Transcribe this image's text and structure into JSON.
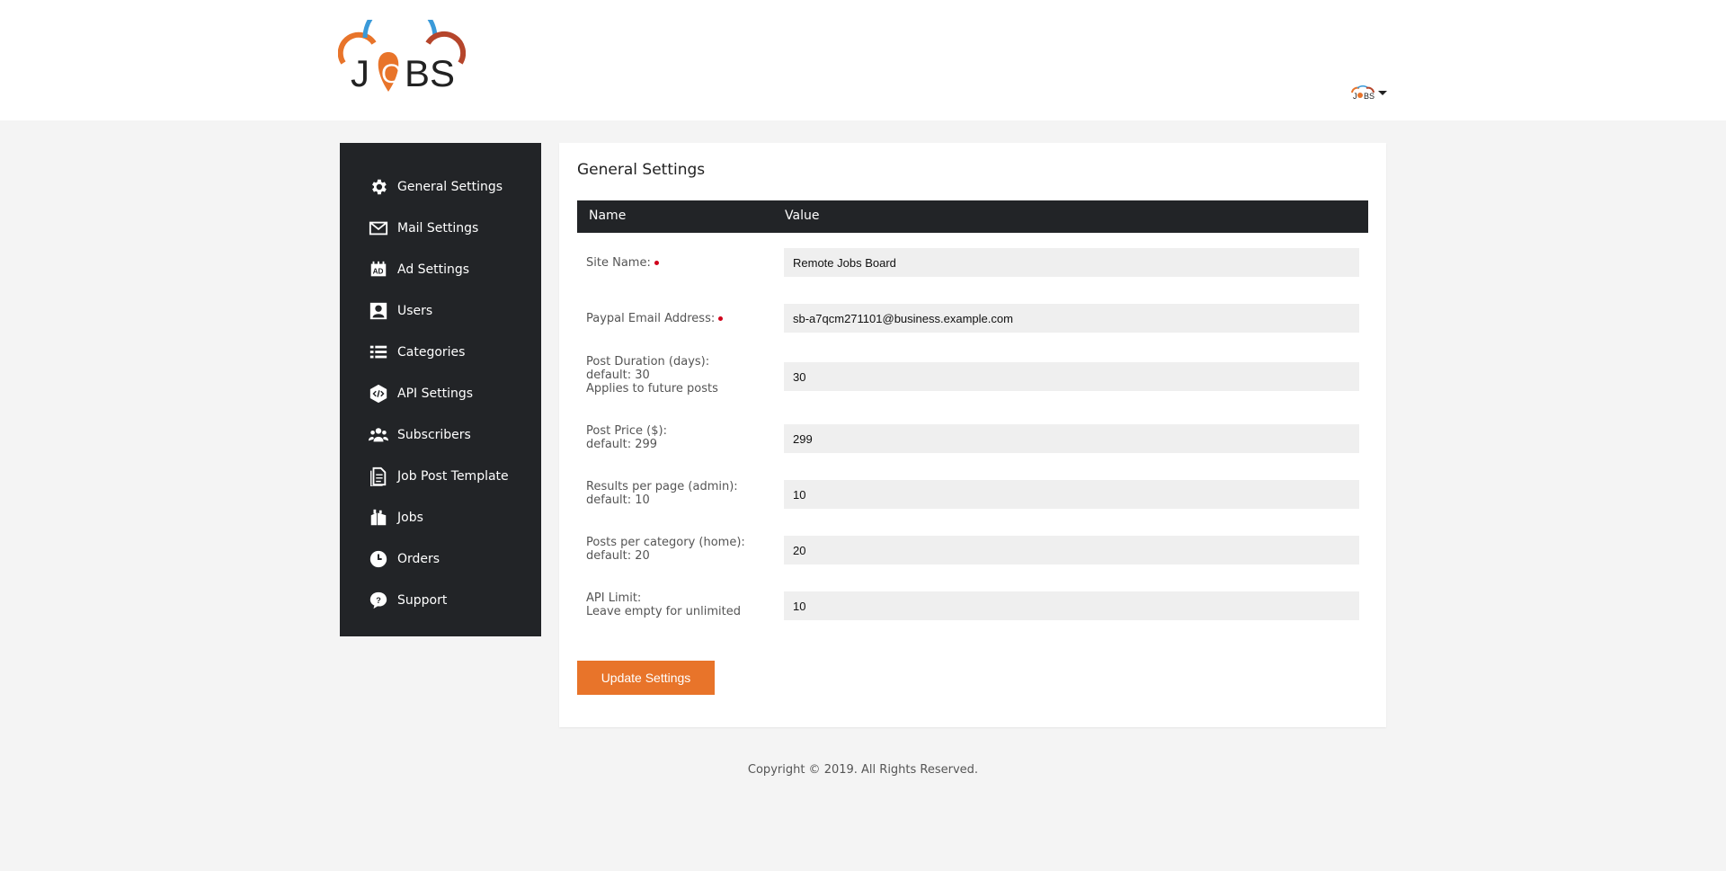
{
  "header": {
    "logo_icon": "jobs-logo",
    "user_menu_icon": "jobs-mini-logo",
    "caret_icon": "caret-down-icon"
  },
  "sidebar": {
    "items": [
      {
        "label": "General Settings",
        "icon": "gear-icon"
      },
      {
        "label": "Mail Settings",
        "icon": "envelope-icon"
      },
      {
        "label": "Ad Settings",
        "icon": "ad-icon"
      },
      {
        "label": "Users",
        "icon": "user-icon"
      },
      {
        "label": "Categories",
        "icon": "list-icon"
      },
      {
        "label": "API Settings",
        "icon": "code-icon"
      },
      {
        "label": "Subscribers",
        "icon": "users-icon"
      },
      {
        "label": "Job Post Template",
        "icon": "document-icon"
      },
      {
        "label": "Jobs",
        "icon": "briefcase-icon"
      },
      {
        "label": "Orders",
        "icon": "clock-icon"
      },
      {
        "label": "Support",
        "icon": "question-icon"
      }
    ]
  },
  "main": {
    "title": "General Settings",
    "columns": {
      "name": "Name",
      "value": "Value"
    },
    "fields": [
      {
        "label_lines": [
          "Site Name:"
        ],
        "required": true,
        "value": "Remote Jobs Board"
      },
      {
        "label_lines": [
          "Paypal Email Address:"
        ],
        "required": true,
        "value": "sb-a7qcm271101@business.example.com"
      },
      {
        "label_lines": [
          "Post Duration (days):",
          "default: 30",
          "Applies to future posts"
        ],
        "required": false,
        "value": "30"
      },
      {
        "label_lines": [
          "Post Price ($):",
          "default: 299"
        ],
        "required": false,
        "value": "299"
      },
      {
        "label_lines": [
          "Results per page (admin):",
          "default: 10"
        ],
        "required": false,
        "value": "10"
      },
      {
        "label_lines": [
          "Posts per category (home):",
          "default: 20"
        ],
        "required": false,
        "value": "20"
      },
      {
        "label_lines": [
          "API Limit:",
          "Leave empty for unlimited"
        ],
        "required": false,
        "value": "10"
      }
    ],
    "update_button": "Update Settings"
  },
  "footer": {
    "text": "Copyright © 2019. All Rights Reserved."
  },
  "colors": {
    "accent": "#e8742a",
    "dark": "#222427",
    "required_dot": "#d0021b"
  }
}
